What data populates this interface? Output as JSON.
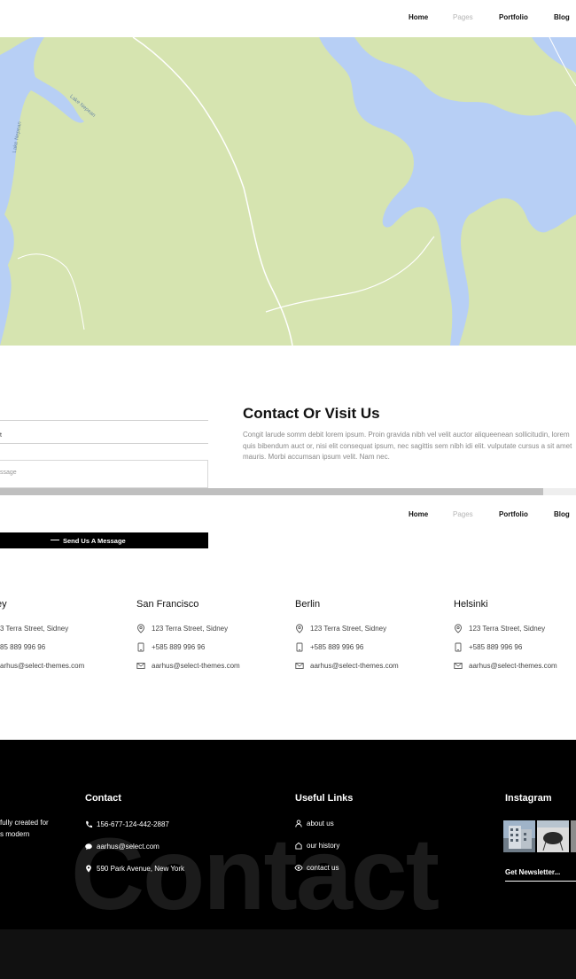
{
  "nav": {
    "items": [
      {
        "label": "Home"
      },
      {
        "label": "Pages"
      },
      {
        "label": "Portfolio"
      },
      {
        "label": "Blog"
      }
    ]
  },
  "map": {
    "labels": [
      "Lake Nepean",
      "Lake Nepean"
    ],
    "colors": {
      "land": "#d6e4b0",
      "water": "#b7cff5",
      "road": "#ffffff"
    }
  },
  "form": {
    "field2_value": "t",
    "message_placeholder": "ssage",
    "send_label": "Send Us A Message"
  },
  "contact": {
    "title": "Contact Or Visit Us",
    "body": "Congit larude somm debit lorem ipsum. Proin gravida nibh vel velit auctor aliqueenean sollicitudin, lorem quis bibendum auct or, nisi elit consequat ipsum, nec sagittis sem nibh idi elit. vulputate cursus a sit amet mauris. Morbi accumsan ipsum velit. Nam nec."
  },
  "offices": [
    {
      "city": "ey",
      "address": "3 Terra Street, Sidney",
      "phone": "85 889 996 96",
      "email": "arhus@select-themes.com"
    },
    {
      "city": "San Francisco",
      "address": "123 Terra Street, Sidney",
      "phone": "+585 889 996 96",
      "email": "aarhus@select-themes.com"
    },
    {
      "city": "Berlin",
      "address": "123 Terra Street, Sidney",
      "phone": "+585 889 996 96",
      "email": "aarhus@select-themes.com"
    },
    {
      "city": "Helsinki",
      "address": "123 Terra Street, Sidney",
      "phone": "+585 889 996 96",
      "email": "aarhus@select-themes.com"
    }
  ],
  "footer": {
    "about_line1": "fully created for",
    "about_line2": "s modern",
    "contact_heading": "Contact",
    "phone": "156-677-124-442-2887",
    "email": "aarhus@select.com",
    "address": "590 Park Avenue, New York",
    "links_heading": "Useful Links",
    "links": [
      "about us",
      "our history",
      "contact us"
    ],
    "instagram_heading": "Instagram",
    "newsletter": "Get Newsletter...",
    "watermark": "Contact"
  }
}
